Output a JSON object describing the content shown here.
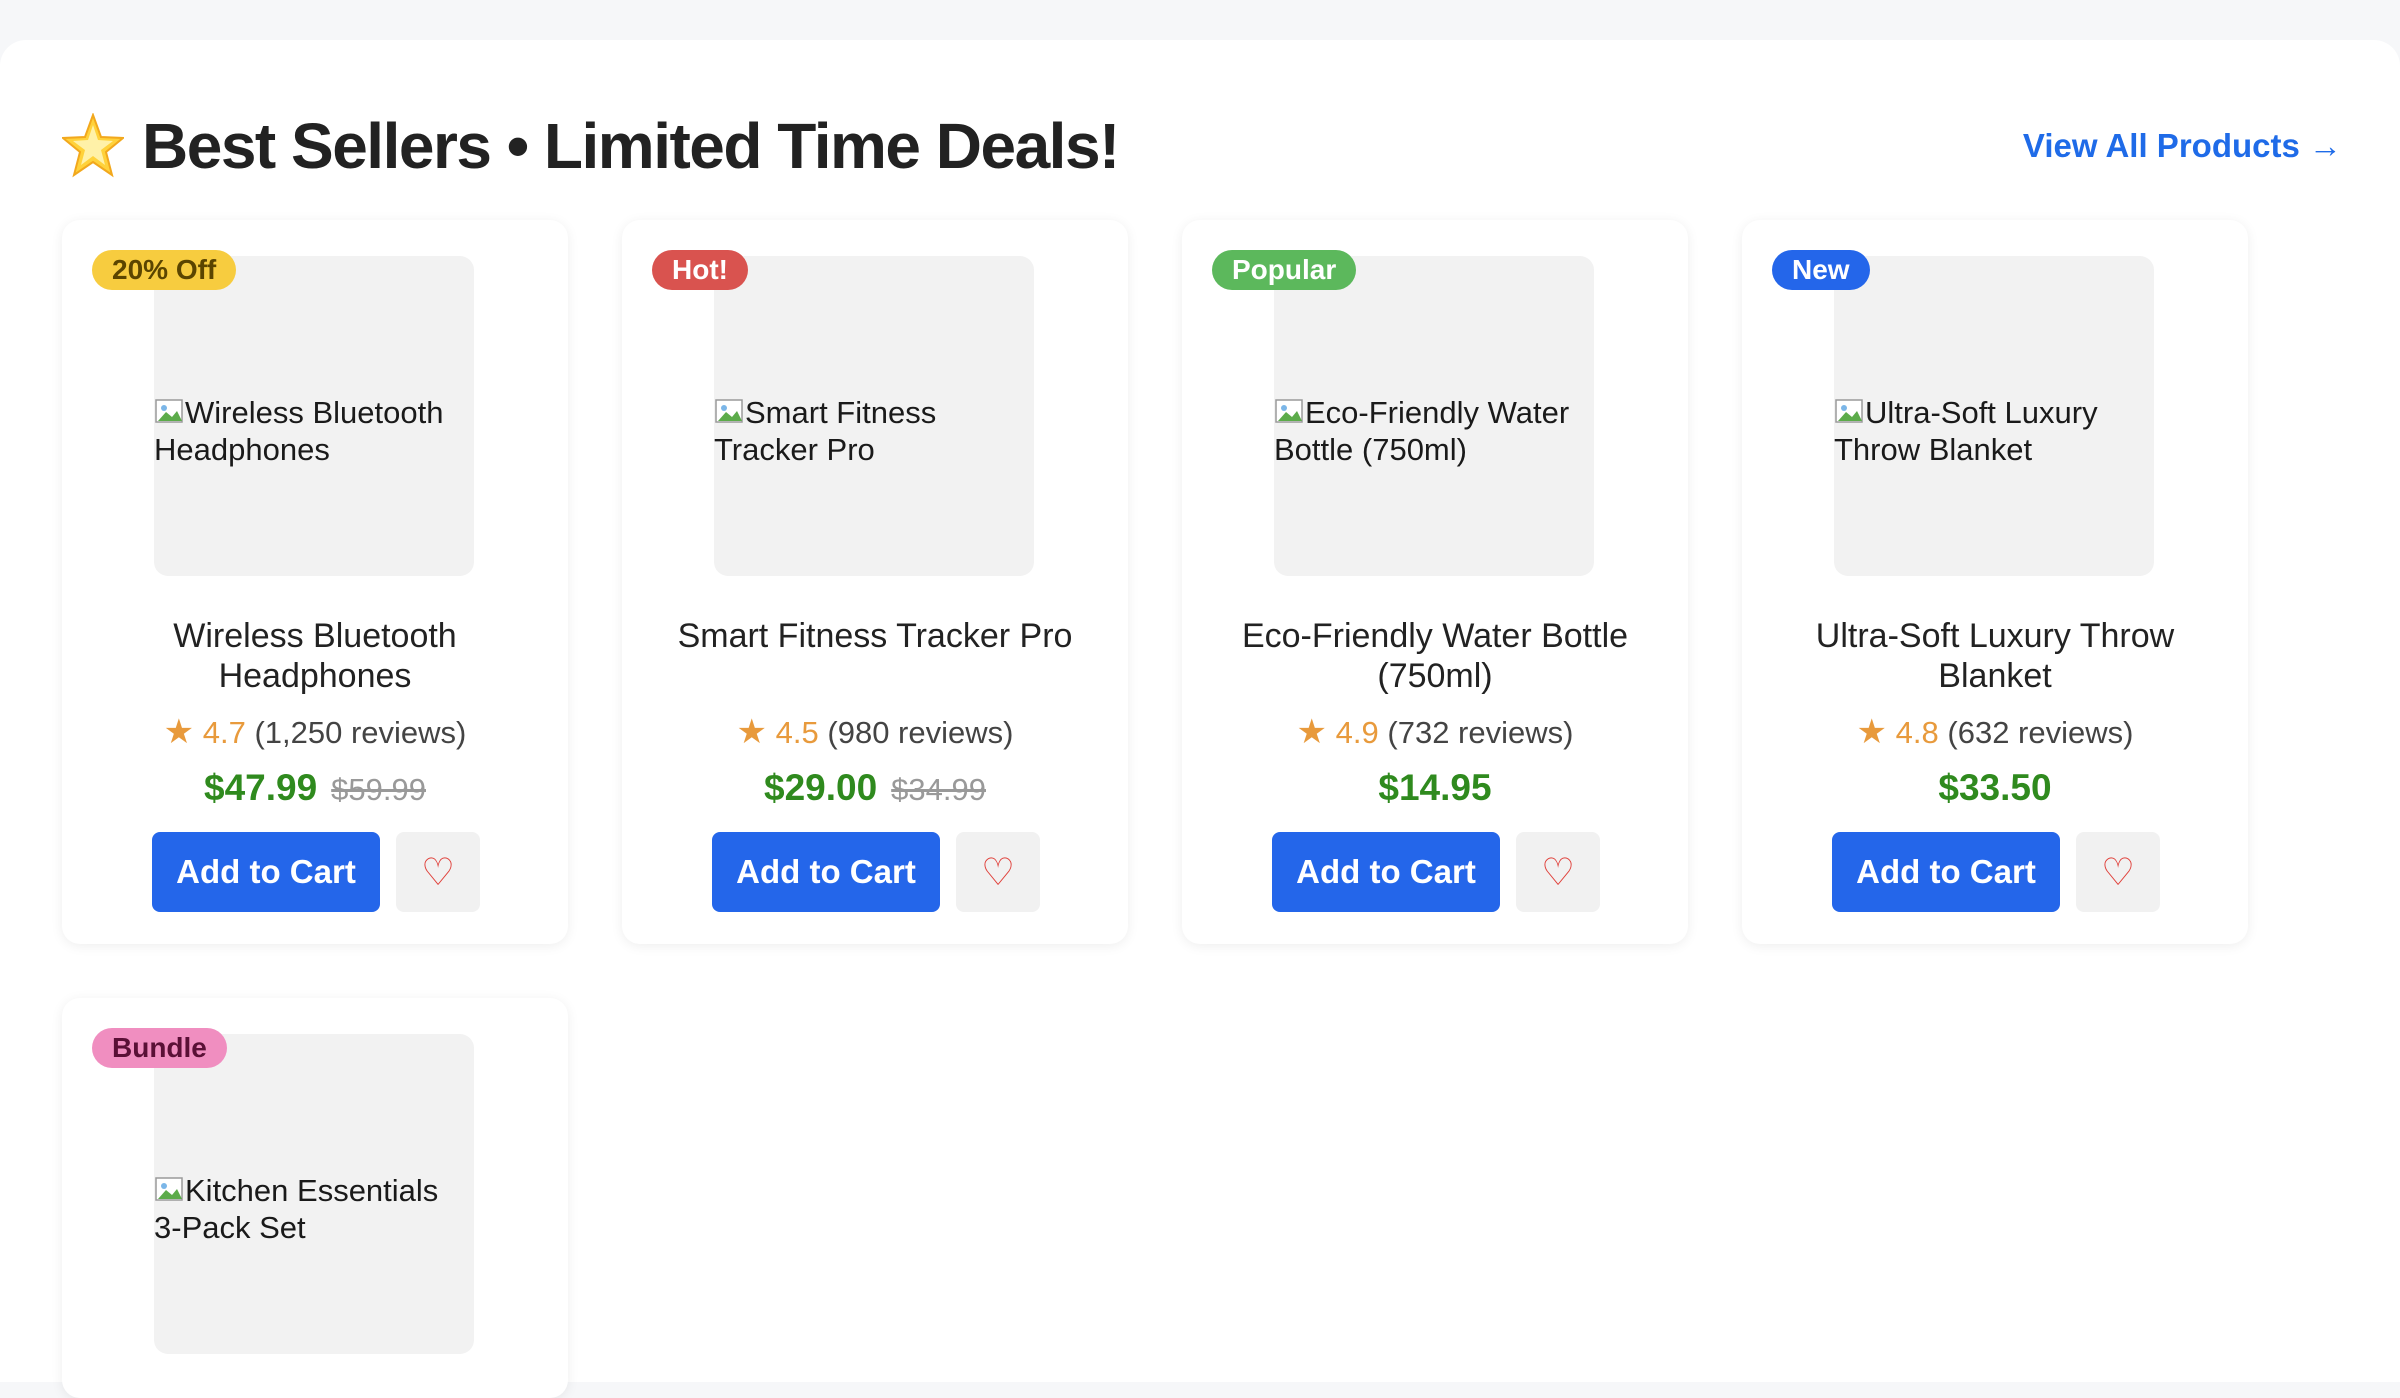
{
  "section": {
    "title": "Best Sellers • Limited Time Deals!",
    "view_all_label": "View All Products →"
  },
  "colors": {
    "accent": "#2466ea",
    "price": "#2f8a1e",
    "rating": "#e89a3c",
    "heart": "#e0403a"
  },
  "products": [
    {
      "badge": "20% Off",
      "badge_bg": "#f7cc3f",
      "badge_fg": "#5b4500",
      "image_alt": "Wireless Bluetooth Headphones",
      "name": "Wireless Bluetooth Headphones",
      "rating_star": "★",
      "rating": "4.7",
      "reviews": "(1,250 reviews)",
      "price": "$47.99",
      "old_price": "$59.99",
      "add_label": "Add to Cart",
      "wish_icon": "♡"
    },
    {
      "badge": "Hot!",
      "badge_bg": "#d9534f",
      "badge_fg": "#ffffff",
      "image_alt": "Smart Fitness Tracker Pro",
      "name": "Smart Fitness Tracker Pro",
      "rating_star": "★",
      "rating": "4.5",
      "reviews": "(980 reviews)",
      "price": "$29.00",
      "old_price": "$34.99",
      "add_label": "Add to Cart",
      "wish_icon": "♡"
    },
    {
      "badge": "Popular",
      "badge_bg": "#5cb85c",
      "badge_fg": "#ffffff",
      "image_alt": "Eco-Friendly Water Bottle (750ml)",
      "name": "Eco-Friendly Water Bottle (750ml)",
      "rating_star": "★",
      "rating": "4.9",
      "reviews": "(732 reviews)",
      "price": "$14.95",
      "old_price": "",
      "add_label": "Add to Cart",
      "wish_icon": "♡"
    },
    {
      "badge": "New",
      "badge_bg": "#2466ea",
      "badge_fg": "#ffffff",
      "image_alt": "Ultra-Soft Luxury Throw Blanket",
      "name": "Ultra-Soft Luxury Throw Blanket",
      "rating_star": "★",
      "rating": "4.8",
      "reviews": "(632 reviews)",
      "price": "$33.50",
      "old_price": "",
      "add_label": "Add to Cart",
      "wish_icon": "♡"
    },
    {
      "badge": "Bundle",
      "badge_bg": "#f08ec0",
      "badge_fg": "#5a1036",
      "image_alt": "Kitchen Essentials 3-Pack Set",
      "name": "",
      "rating_star": "",
      "rating": "",
      "reviews": "",
      "price": "",
      "old_price": "",
      "add_label": "",
      "wish_icon": ""
    }
  ]
}
